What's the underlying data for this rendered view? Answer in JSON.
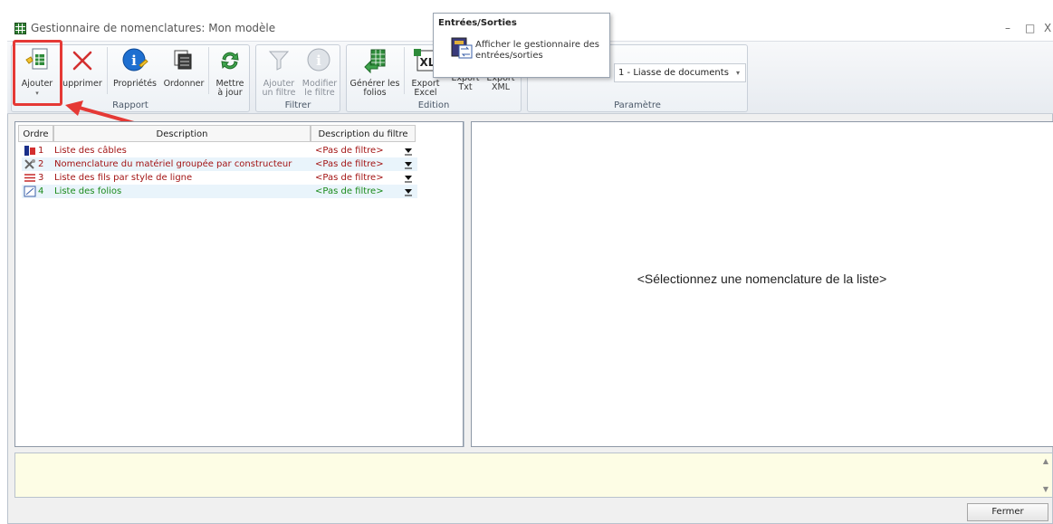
{
  "window": {
    "title": "Gestionnaire de nomenclatures: Mon modèle",
    "minimize": "–",
    "maximize": "□",
    "close": "X"
  },
  "ribbon": {
    "buttons": {
      "add": "Ajouter",
      "delete": "upprimer",
      "properties": "Propriétés",
      "order": "Ordonner",
      "update_1": "Mettre",
      "update_2": "à jour",
      "add_filter_1": "Ajouter",
      "add_filter_2": "un filtre",
      "edit_filter_1": "Modifier",
      "edit_filter_2": "le filtre",
      "generate_1": "Générer les",
      "generate_2": "folios",
      "export_excel_1": "Export",
      "export_excel_2": "Excel",
      "export_txt_1": "Export",
      "export_txt_2": "Txt",
      "export_xml_1": "Export",
      "export_xml_2": "XML"
    },
    "groups": {
      "report": "Rapport",
      "filter": "Filtrer",
      "edition": "Edition",
      "parameter": "Paramètre"
    },
    "parameter_select": "1 - Liasse de documents"
  },
  "tooltip": {
    "title": "Entrées/Sorties",
    "text_1": "Afficher le gestionnaire des",
    "text_2": "entrées/sorties"
  },
  "table": {
    "headers": {
      "order": "Ordre",
      "description": "Description",
      "filter": "Description du filtre"
    },
    "rows": [
      {
        "num": "1",
        "description": "Liste des câbles",
        "filter": "<Pas de filtre>"
      },
      {
        "num": "2",
        "description": "Nomenclature du matériel groupée par constructeur",
        "filter": "<Pas de filtre>"
      },
      {
        "num": "3",
        "description": "Liste des fils par style de ligne",
        "filter": "<Pas de filtre>"
      },
      {
        "num": "4",
        "description": "Liste des folios",
        "filter": "<Pas de filtre>"
      }
    ]
  },
  "detail_placeholder": "<Sélectionnez une nomenclature de la liste>",
  "footer": {
    "close_label": "Fermer"
  },
  "colors": {
    "accent_red": "#e53935",
    "row_text_red": "#a31515",
    "row_text_green": "#1a8a1a",
    "info_bg": "#fdfde5"
  }
}
